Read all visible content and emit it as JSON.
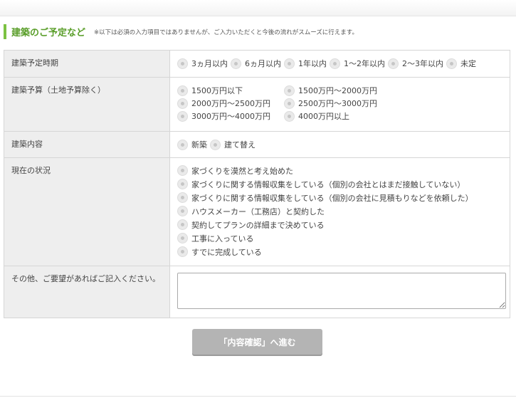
{
  "section": {
    "title": "建築のご予定など",
    "note": "※以下は必須の入力項目ではありませんが、ご入力いただくと今後の流れがスムーズに行えます。"
  },
  "rows": {
    "schedule": {
      "label": "建築予定時期",
      "options": [
        "3ヵ月以内",
        "6ヵ月以内",
        "1年以内",
        "1〜2年以内",
        "2〜3年以内",
        "未定"
      ]
    },
    "budget": {
      "label": "建築予算（土地予算除く）",
      "options": [
        "1500万円以下",
        "1500万円〜2000万円",
        "2000万円〜2500万円",
        "2500万円〜3000万円",
        "3000万円〜4000万円",
        "4000万円以上"
      ]
    },
    "content": {
      "label": "建築内容",
      "options": [
        "新築",
        "建て替え"
      ]
    },
    "status": {
      "label": "現在の状況",
      "options": [
        "家づくりを漠然と考え始めた",
        "家づくりに関する情報収集をしている（個別の会社とはまだ接触していない）",
        "家づくりに関する情報収集をしている（個別の会社に見積もりなどを依頼した）",
        "ハウスメーカー（工務店）と契約した",
        "契約してプランの詳細まで決めている",
        "工事に入っている",
        "すでに完成している"
      ]
    },
    "request": {
      "label": "その他、ご要望があればご記入ください。",
      "value": "",
      "placeholder": ""
    }
  },
  "submit_label": "「内容確認」へ進む",
  "colors": {
    "accent": "#7cc242",
    "title": "#5a9e2a",
    "label_bg": "#eeeeee",
    "button_bg": "#b4b4b4"
  }
}
